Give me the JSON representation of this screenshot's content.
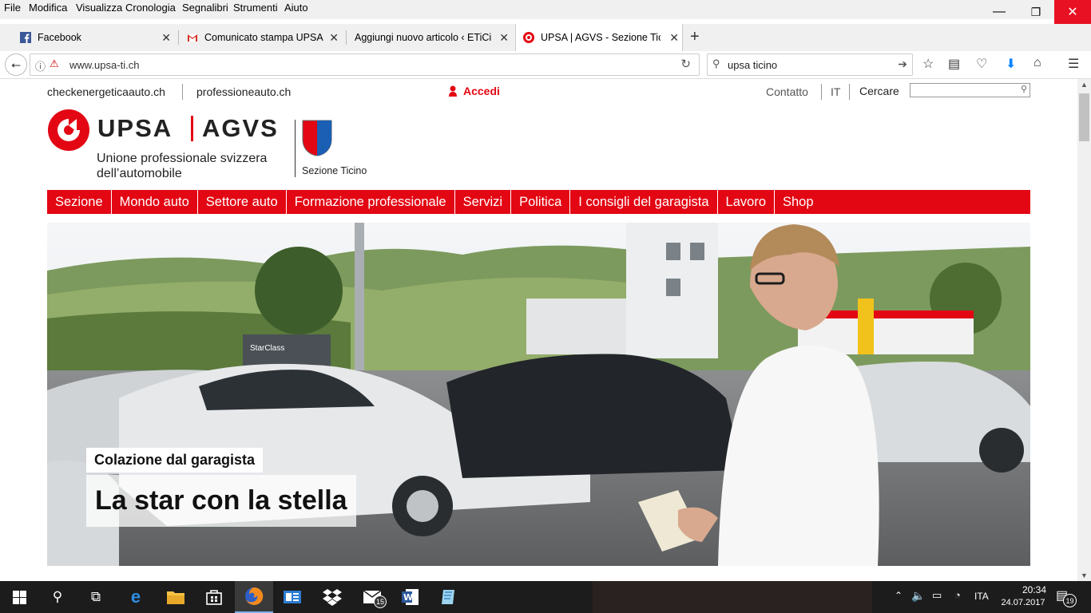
{
  "menubar": {
    "items": [
      "File",
      "Modifica",
      "Visualizza",
      "Cronologia",
      "Segnalibri",
      "Strumenti",
      "Aiuto"
    ]
  },
  "window_controls": {
    "minimize": "—",
    "restore": "❐",
    "close": "✕"
  },
  "tabs": [
    {
      "label": "Facebook",
      "icon": "facebook-icon"
    },
    {
      "label": "Comunicato stampa UPSA T",
      "icon": "gmail-icon"
    },
    {
      "label": "Aggiungi nuovo articolo ‹ ETiCin",
      "icon": "none"
    },
    {
      "label": "UPSA | AGVS - Sezione Ticino",
      "icon": "upsa-icon",
      "active": true
    }
  ],
  "new_tab": "+",
  "address": {
    "url": "www.upsa-ti.ch"
  },
  "search": {
    "value": "upsa ticino"
  },
  "site": {
    "toplinks": [
      "checkenergeticaauto.ch",
      "professioneauto.ch"
    ],
    "login_label": "Accedi",
    "right_links": {
      "contact": "Contatto",
      "lang": "IT",
      "search_label": "Cercare"
    },
    "search_placeholder": "",
    "logo": {
      "brand_left": "UPSA",
      "brand_right": "AGVS",
      "tagline_1": "Unione professionale svizzera",
      "tagline_2": "dell’automobile",
      "section": "Sezione Ticino"
    },
    "nav": [
      "Sezione",
      "Mondo auto",
      "Settore auto",
      "Formazione professionale",
      "Servizi",
      "Politica",
      "I consigli del garagista",
      "Lavoro",
      "Shop"
    ],
    "hero": {
      "kicker": "Colazione dal garagista",
      "headline": "La star con la stella",
      "sign_text": "StarClass"
    }
  },
  "taskbar": {
    "language": "ITA",
    "time": "20:34",
    "date": "24.07.2017",
    "mail_badge": "15",
    "notification_count": "19"
  },
  "colors": {
    "brand_red": "#e30613",
    "taskbar": "#1c1c1c",
    "download_blue": "#0a84ff"
  }
}
